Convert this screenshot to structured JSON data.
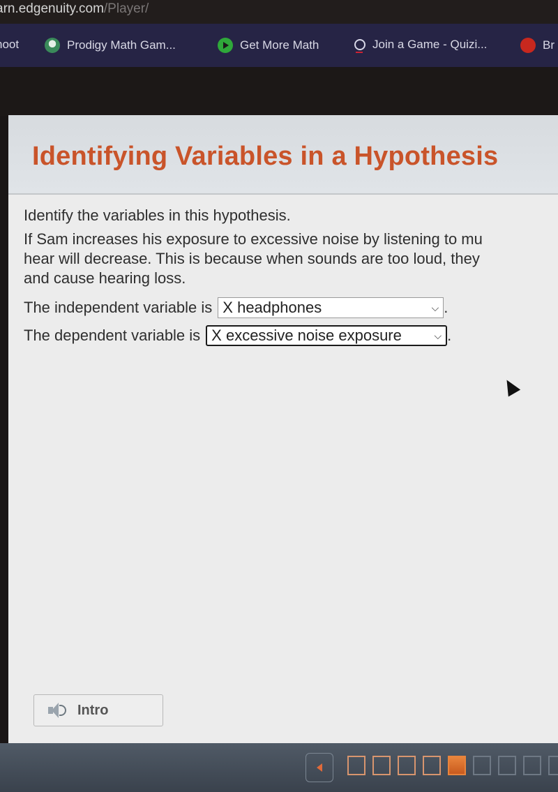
{
  "browser": {
    "url_host": "arn.edgenuity.com",
    "url_path": "/Player/",
    "bookmarks": [
      {
        "label": "hoot",
        "icon": "kahoot-icon"
      },
      {
        "label": "Prodigy Math Gam...",
        "icon": "prodigy-icon"
      },
      {
        "label": "Get More Math",
        "icon": "play-icon"
      },
      {
        "label": "Join a Game - Quizi...",
        "icon": "quizizz-icon"
      },
      {
        "label": "Br",
        "icon": "brainpop-icon"
      }
    ]
  },
  "lesson": {
    "title": "Identifying Variables in a Hypothesis",
    "prompt": "Identify the variables in this hypothesis.",
    "hypothesis_lines": [
      "If Sam increases his exposure to excessive noise by listening to mu",
      "hear will decrease. This is because when sounds are too loud, they",
      "and cause hearing loss."
    ],
    "independent_label": "The independent variable is",
    "independent_value": "X headphones",
    "dependent_label": "The dependent variable is",
    "dependent_value": "X excessive noise exposure",
    "period": ".",
    "chevron": "⌄"
  },
  "intro_button": {
    "label": "Intro",
    "icon": "speaker-icon"
  },
  "pagination": {
    "total_visible": 10,
    "current_index": 5,
    "states": [
      "done",
      "done",
      "done",
      "done",
      "current",
      "todo",
      "todo",
      "todo",
      "todo",
      "todo"
    ]
  }
}
